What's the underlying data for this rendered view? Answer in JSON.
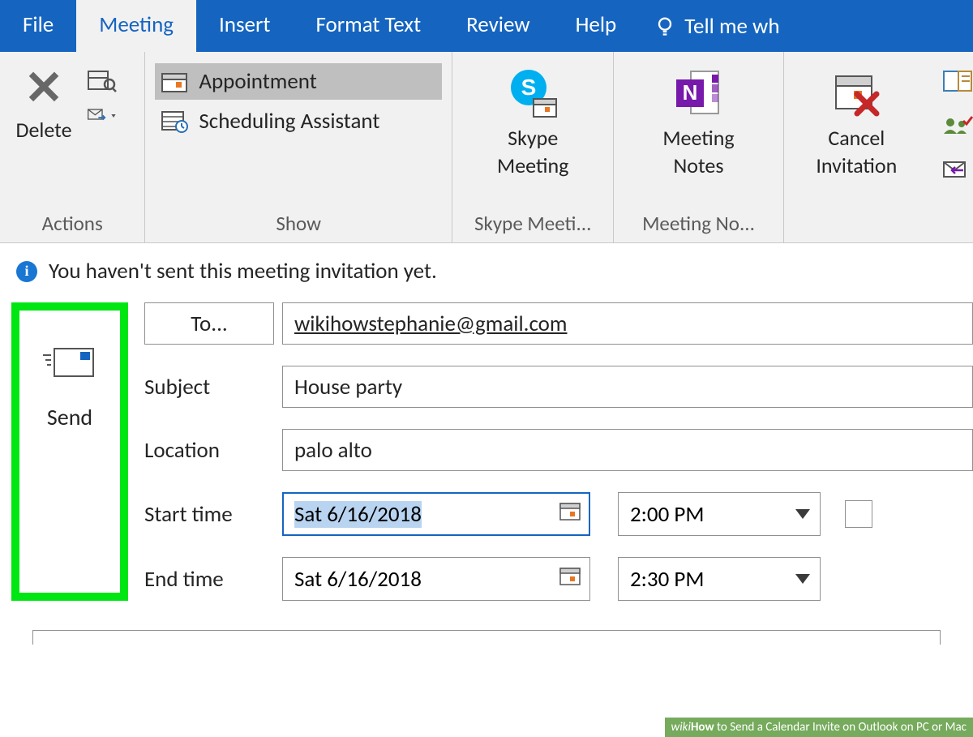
{
  "tabs": {
    "file": "File",
    "meeting": "Meeting",
    "insert": "Insert",
    "format_text": "Format Text",
    "review": "Review",
    "help": "Help",
    "tellme": "Tell me wh"
  },
  "ribbon": {
    "actions": {
      "delete": "Delete",
      "label": "Actions"
    },
    "show": {
      "appointment": "Appointment",
      "scheduling": "Scheduling Assistant",
      "label": "Show"
    },
    "skype": {
      "title": "Skype\nMeeting",
      "label": "Skype Meeti..."
    },
    "notes": {
      "title": "Meeting\nNotes",
      "label": "Meeting No..."
    },
    "cancel": {
      "title": "Cancel\nInvitation"
    }
  },
  "info": {
    "text": "You haven't sent this meeting invitation yet."
  },
  "form": {
    "send": "Send",
    "to_label": "To...",
    "to_value": "wikihowstephanie@gmail.com",
    "subject_label": "Subject",
    "subject_value": "House party",
    "location_label": "Location",
    "location_value": "palo alto",
    "start_label": "Start time",
    "start_date": "Sat 6/16/2018",
    "start_time": "2:00 PM",
    "end_label": "End time",
    "end_date": "Sat 6/16/2018",
    "end_time": "2:30 PM"
  },
  "watermark": {
    "prefix": "wiki",
    "mid": "How",
    "suffix": " to Send a Calendar Invite on Outlook on PC or Mac"
  }
}
